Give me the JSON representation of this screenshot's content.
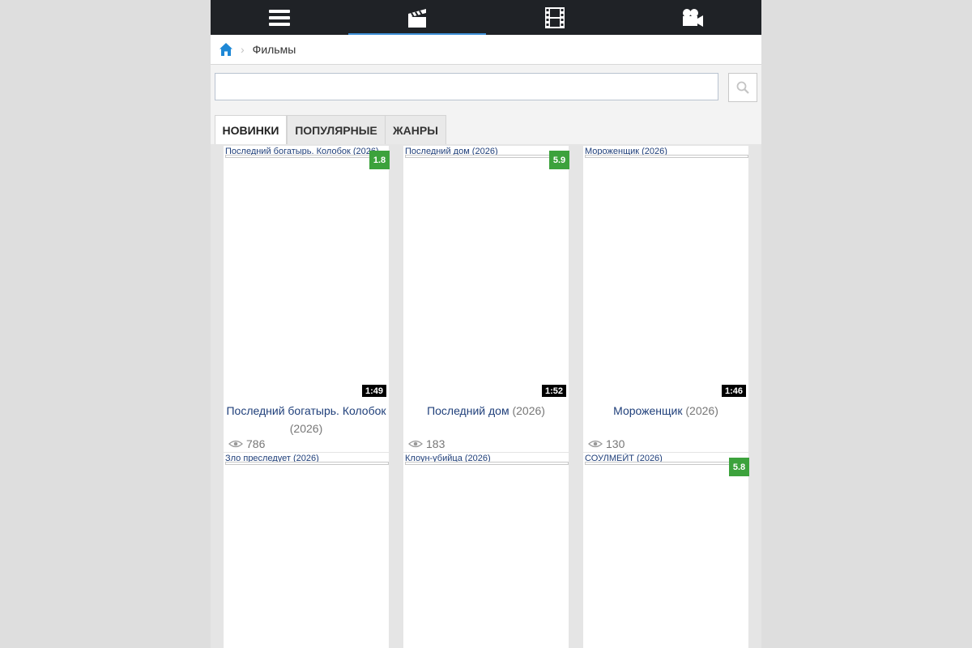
{
  "nav": {
    "items": [
      {
        "icon": "menu-icon"
      },
      {
        "icon": "clapperboard-icon"
      },
      {
        "icon": "film-strip-icon"
      },
      {
        "icon": "movie-camera-icon"
      }
    ],
    "active_index": 1
  },
  "breadcrumb": {
    "home_icon": "home-icon",
    "current": "Фильмы"
  },
  "search": {
    "value": "",
    "placeholder": "",
    "button_icon": "search-icon"
  },
  "tabs": [
    {
      "label": "НОВИНКИ"
    },
    {
      "label": "ПОПУЛЯРНЫЕ"
    },
    {
      "label": "ЖАНРЫ"
    }
  ],
  "movies": [
    {
      "top_title": "Последний богатырь. Колобок (2026)",
      "rating": "1.8",
      "duration": "1:49",
      "name": "Последний богатырь. Колобок",
      "year": "(2026)",
      "views": "786"
    },
    {
      "top_title": "Последний дом (2026)",
      "rating": "5.9",
      "duration": "1:52",
      "name": "Последний дом",
      "year": "(2026)",
      "views": "183"
    },
    {
      "top_title": "Мороженщик (2026)",
      "rating": "",
      "duration": "1:46",
      "name": "Мороженщик",
      "year": "(2026)",
      "views": "130"
    },
    {
      "top_title": "Зло преследует (2026)",
      "rating": "",
      "duration": "",
      "name": "",
      "year": "",
      "views": ""
    },
    {
      "top_title": "Клоун-убийца (2026)",
      "rating": "",
      "duration": "",
      "name": "",
      "year": "",
      "views": ""
    },
    {
      "top_title": "СОУЛМЕЙТ (2026)",
      "rating": "5.8",
      "duration": "",
      "name": "",
      "year": "",
      "views": ""
    }
  ],
  "colors": {
    "nav_bg": "#1f2226",
    "nav_active": "#3d8fd6",
    "rating_bg": "#3ca23c",
    "link": "#1f3f7a"
  }
}
